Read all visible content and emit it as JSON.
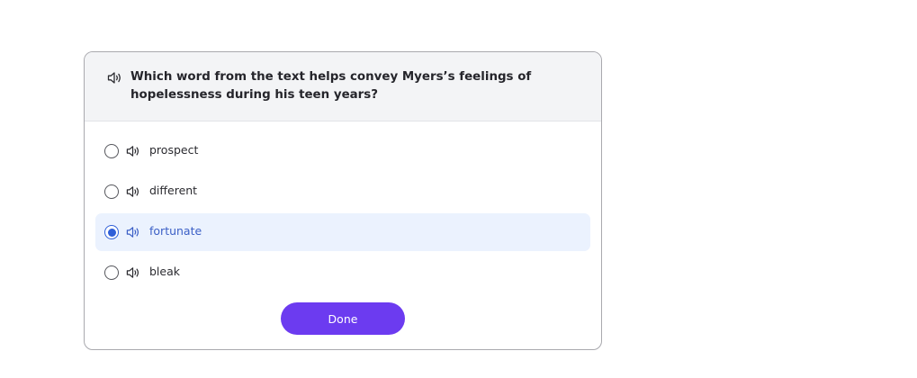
{
  "question": {
    "audio_icon": "speaker-icon",
    "text": "Which word from the text helps convey Myers’s feelings of hopelessness during his teen years?"
  },
  "options": [
    {
      "label": "prospect",
      "selected": false,
      "audio_icon": "speaker-icon"
    },
    {
      "label": "different",
      "selected": false,
      "audio_icon": "speaker-icon"
    },
    {
      "label": "fortunate",
      "selected": true,
      "audio_icon": "speaker-icon"
    },
    {
      "label": "bleak",
      "selected": false,
      "audio_icon": "speaker-icon"
    }
  ],
  "done_button": {
    "label": "Done"
  },
  "colors": {
    "accent": "#6c3bf0",
    "selected_bg": "#ebf2fe",
    "selected_text": "#3b5fc6",
    "radio_selected": "#2f5fd8"
  }
}
